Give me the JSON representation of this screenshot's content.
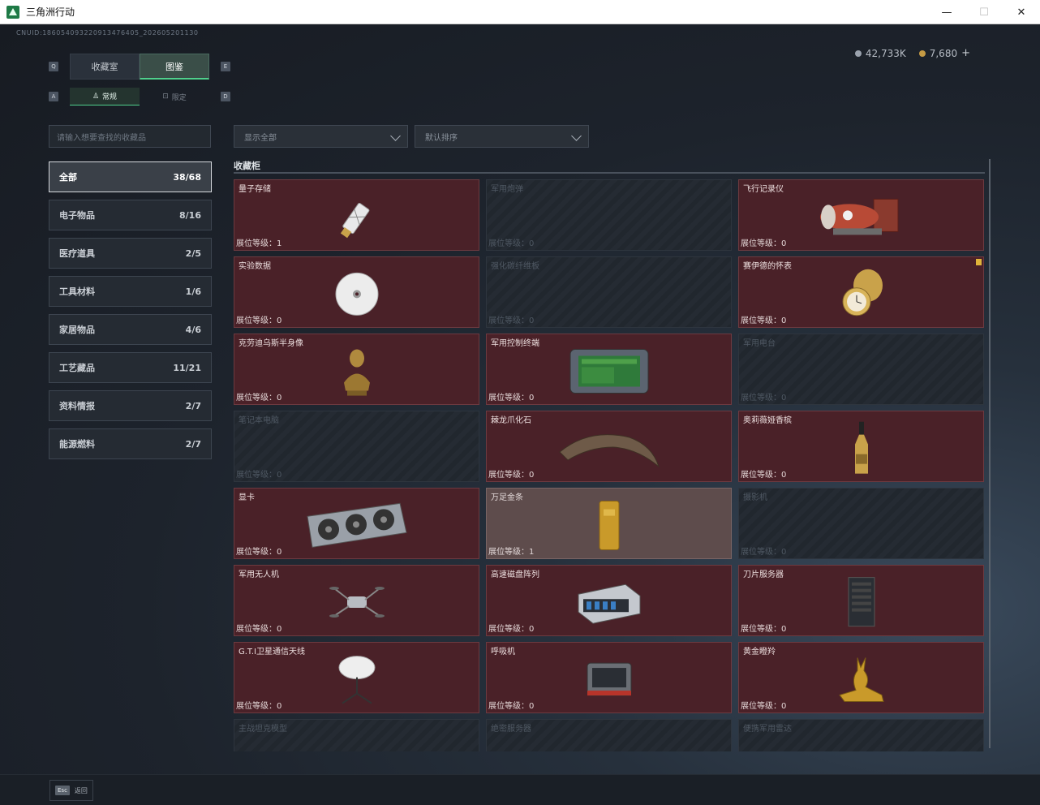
{
  "window": {
    "title": "三角洲行动",
    "minimize": "—",
    "maximize": "☐",
    "close": "✕",
    "icon": "delta-logo-icon"
  },
  "header": {
    "uid": "CNUID:186054093220913476405_202605201130",
    "currency": {
      "silver": "42,733K",
      "gold": "7,680",
      "plus": "+"
    }
  },
  "tabs": {
    "left_key": "Q",
    "right_key": "E",
    "items": [
      {
        "label": "收藏室",
        "active": false
      },
      {
        "label": "图鉴",
        "active": true
      }
    ]
  },
  "subtabs": {
    "left_key": "A",
    "right_key": "D",
    "items": [
      {
        "label": "常规",
        "icon": "figure-icon",
        "active": true
      },
      {
        "label": "限定",
        "icon": "box-icon",
        "active": false
      }
    ]
  },
  "search": {
    "placeholder": "请输入想要查找的收藏品"
  },
  "filters": {
    "display": "显示全部",
    "sort": "默认排序"
  },
  "categories": [
    {
      "label": "全部",
      "count": "38/68",
      "active": true
    },
    {
      "label": "电子物品",
      "count": "8/16"
    },
    {
      "label": "医疗道具",
      "count": "2/5"
    },
    {
      "label": "工具材料",
      "count": "1/6"
    },
    {
      "label": "家居物品",
      "count": "4/6"
    },
    {
      "label": "工艺藏品",
      "count": "11/21"
    },
    {
      "label": "资料情报",
      "count": "2/7"
    },
    {
      "label": "能源燃料",
      "count": "2/7"
    }
  ],
  "section": {
    "title": "收藏柜"
  },
  "items": [
    {
      "name": "量子存储",
      "level": "展位等级：1",
      "state": "owned",
      "icon": "usb-drive-icon"
    },
    {
      "name": "军用炮弹",
      "level": "展位等级：0",
      "state": "locked",
      "icon": "shell-icon"
    },
    {
      "name": "飞行记录仪",
      "level": "展位等级：0",
      "state": "owned",
      "icon": "flight-recorder-icon"
    },
    {
      "name": "实验数据",
      "level": "展位等级：0",
      "state": "owned",
      "icon": "disc-icon"
    },
    {
      "name": "强化碳纤维板",
      "level": "展位等级：0",
      "state": "locked",
      "icon": "plate-icon"
    },
    {
      "name": "赛伊德的怀表",
      "level": "展位等级：0",
      "state": "owned",
      "icon": "pocket-watch-icon",
      "flag": true
    },
    {
      "name": "克劳迪乌斯半身像",
      "level": "展位等级：0",
      "state": "owned",
      "icon": "bust-icon"
    },
    {
      "name": "军用控制终端",
      "level": "展位等级：0",
      "state": "owned",
      "icon": "terminal-icon"
    },
    {
      "name": "军用电台",
      "level": "展位等级：0",
      "state": "locked",
      "icon": "radio-icon"
    },
    {
      "name": "笔记本电脑",
      "level": "展位等级：0",
      "state": "locked",
      "icon": "laptop-icon"
    },
    {
      "name": "棘龙爪化石",
      "level": "展位等级：0",
      "state": "owned",
      "icon": "claw-fossil-icon"
    },
    {
      "name": "奥莉薇娅香槟",
      "level": "展位等级：0",
      "state": "owned",
      "icon": "champagne-icon"
    },
    {
      "name": "显卡",
      "level": "展位等级：0",
      "state": "owned",
      "icon": "graphics-card-icon"
    },
    {
      "name": "万足金条",
      "level": "展位等级：1",
      "state": "gold",
      "icon": "gold-bar-icon"
    },
    {
      "name": "摄影机",
      "level": "展位等级：0",
      "state": "locked",
      "icon": "camera-icon"
    },
    {
      "name": "军用无人机",
      "level": "展位等级：0",
      "state": "owned",
      "icon": "drone-icon"
    },
    {
      "name": "高速磁盘阵列",
      "level": "展位等级：0",
      "state": "owned",
      "icon": "disk-array-icon"
    },
    {
      "name": "刀片服务器",
      "level": "展位等级：0",
      "state": "owned",
      "icon": "blade-server-icon"
    },
    {
      "name": "G.T.I卫星通信天线",
      "level": "展位等级：0",
      "state": "owned",
      "icon": "satellite-dish-icon"
    },
    {
      "name": "呼吸机",
      "level": "展位等级：0",
      "state": "owned",
      "icon": "ventilator-icon"
    },
    {
      "name": "黄金瞪羚",
      "level": "展位等级：0",
      "state": "owned",
      "icon": "gold-gazelle-icon"
    },
    {
      "name": "主战坦克模型",
      "level": "",
      "state": "locked",
      "icon": "tank-model-icon"
    },
    {
      "name": "绝密服务器",
      "level": "",
      "state": "locked",
      "icon": "server-icon"
    },
    {
      "name": "便携军用雷达",
      "level": "",
      "state": "locked",
      "icon": "radar-icon"
    }
  ],
  "footer": {
    "esc_key": "Esc",
    "esc_label": "返回"
  }
}
